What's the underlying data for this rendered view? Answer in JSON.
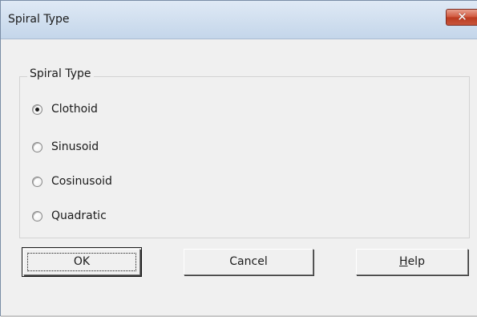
{
  "window": {
    "title": "Spiral Type",
    "close_glyph": "✕"
  },
  "group": {
    "label": "Spiral Type",
    "options": [
      {
        "label": "Clothoid",
        "checked": true
      },
      {
        "label": "Sinusoid",
        "checked": false
      },
      {
        "label": "Cosinusoid",
        "checked": false
      },
      {
        "label": "Quadratic",
        "checked": false
      }
    ]
  },
  "buttons": {
    "ok": "OK",
    "cancel": "Cancel",
    "help_underlined": "H",
    "help_rest": "elp"
  },
  "colors": {
    "titlebar": "#c4d6ea",
    "close": "#c7553b",
    "window_bg": "#f0f0f0"
  }
}
